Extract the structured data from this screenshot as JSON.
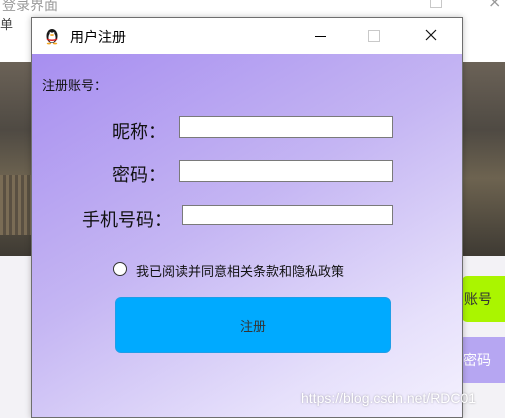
{
  "background_window": {
    "title": "登录界面",
    "menu_label": "单",
    "buttons": {
      "account": "账号",
      "password": "密码"
    },
    "colors": {
      "account_button": "#aaf500",
      "password_button": "#b6a6f2"
    }
  },
  "dialog": {
    "title": "用户注册",
    "icon": "penguin-icon",
    "section_label": "注册账号：",
    "fields": {
      "nickname": {
        "label": "昵称：",
        "value": "",
        "placeholder": ""
      },
      "password": {
        "label": "密码：",
        "value": "",
        "placeholder": ""
      },
      "phone": {
        "label": "手机号码：",
        "value": "",
        "placeholder": ""
      }
    },
    "agreement": {
      "label": "我已阅读并同意相关条款和隐私政策",
      "checked": false
    },
    "register_button": "注册",
    "colors": {
      "register_button": "#00aaff",
      "gradient_start": "#a78ef0",
      "gradient_end": "#f4f1fe"
    }
  },
  "watermark": "https://blog.csdn.net/RDC01"
}
